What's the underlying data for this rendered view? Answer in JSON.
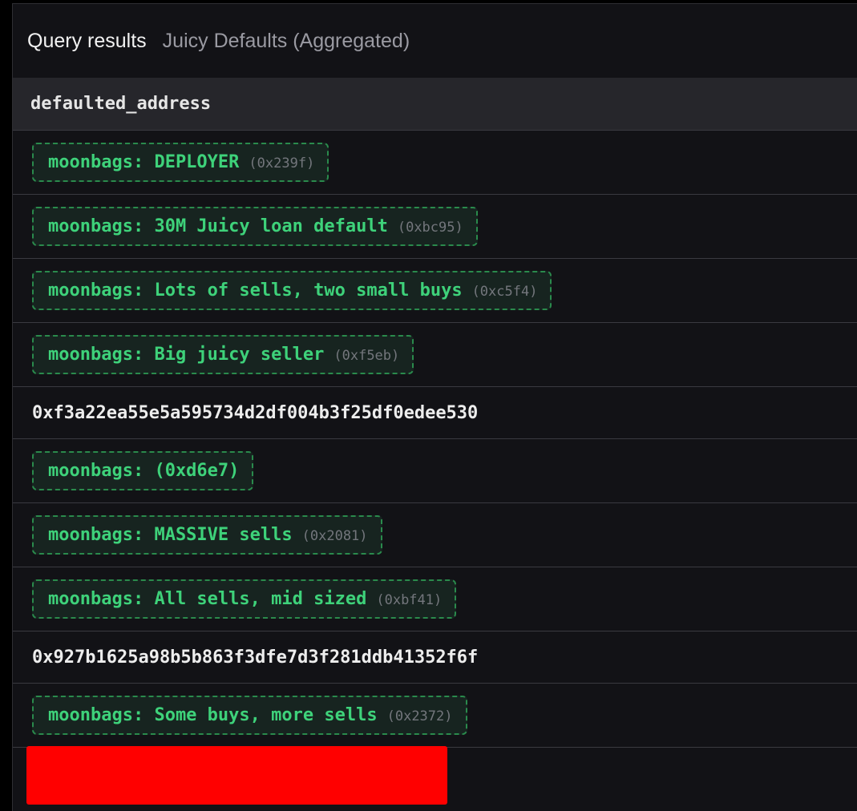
{
  "header": {
    "title": "Query results",
    "subtitle": "Juicy Defaults (Aggregated)"
  },
  "table": {
    "column": "defaulted_address",
    "rows": [
      {
        "type": "tag",
        "label": "moonbags: DEPLOYER",
        "addr": "(0x239f)"
      },
      {
        "type": "tag",
        "label": "moonbags: 30M Juicy loan default",
        "addr": "(0xbc95)"
      },
      {
        "type": "tag",
        "label": "moonbags: Lots of sells, two small buys",
        "addr": "(0xc5f4)"
      },
      {
        "type": "tag",
        "label": "moonbags: Big juicy seller",
        "addr": "(0xf5eb)"
      },
      {
        "type": "text",
        "value": "0xf3a22ea55e5a595734d2df004b3f25df0edee530"
      },
      {
        "type": "tag",
        "label": "moonbags: (0xd6e7)",
        "addr": ""
      },
      {
        "type": "tag",
        "label": "moonbags: MASSIVE sells",
        "addr": "(0x2081)"
      },
      {
        "type": "tag",
        "label": "moonbags: All sells, mid sized",
        "addr": "(0xbf41)"
      },
      {
        "type": "text",
        "value": "0x927b1625a98b5b863f3dfe7d3f281ddb41352f6f"
      },
      {
        "type": "tag",
        "label": "moonbags: Some buys, more sells",
        "addr": "(0x2372)"
      }
    ]
  },
  "colors": {
    "tag_text": "#3ed27a",
    "tag_border": "#2a8a4c",
    "redaction": "#ff0000"
  }
}
